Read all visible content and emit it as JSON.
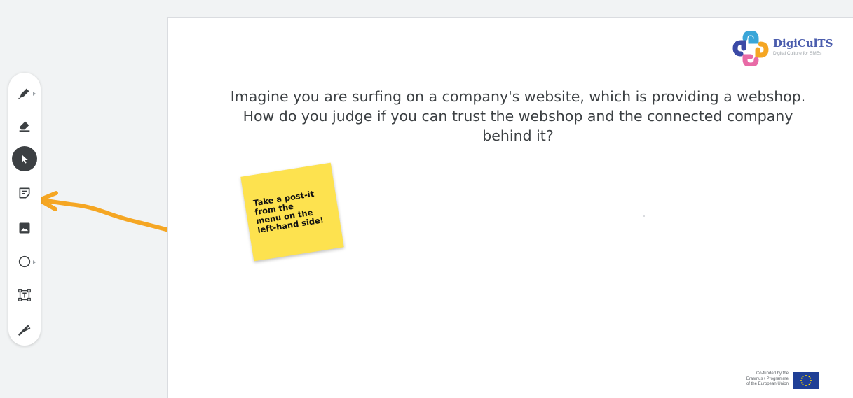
{
  "colors": {
    "background": "#f1f3f4",
    "toolbar": "#ffffff",
    "selected_tool": "#3c4043",
    "postit": "#fde24f",
    "arrow": "#f5a623",
    "logo_text": "#4a5cad",
    "eu_blue": "#1f3f96"
  },
  "toolbar": {
    "tools": [
      {
        "name": "pen",
        "icon": "pen-icon",
        "has_submenu": true
      },
      {
        "name": "eraser",
        "icon": "eraser-icon",
        "has_submenu": false
      },
      {
        "name": "select",
        "icon": "cursor-icon",
        "selected": true
      },
      {
        "name": "sticky-note",
        "icon": "sticky-note-icon"
      },
      {
        "name": "image",
        "icon": "image-icon"
      },
      {
        "name": "shape",
        "icon": "circle-shape-icon",
        "has_submenu": true
      },
      {
        "name": "text-box",
        "icon": "text-box-icon"
      },
      {
        "name": "laser",
        "icon": "laser-pointer-icon"
      }
    ]
  },
  "canvas": {
    "question": "Imagine you are surfing on a company's website, which is providing a webshop.\nHow do you judge if you can trust the webshop and the connected company\nbehind it?",
    "logo": {
      "name": "DigiCulTS",
      "tagline": "Digital Culture for SMEs"
    },
    "postit": {
      "text": "Take a post-it\nfrom the\nmenu on the\nleft-hand side!"
    },
    "funding": {
      "text": "Co-funded by the\nErasmus+ Programme\nof the European Union"
    }
  }
}
